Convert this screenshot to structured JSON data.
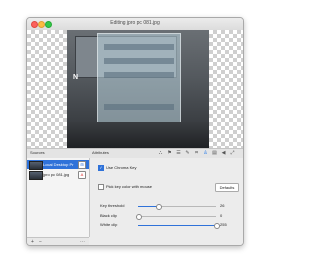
{
  "window": {
    "title": "Editing jpro pc 081.jpg"
  },
  "canvas": {
    "wordmark": "N"
  },
  "toolbar": {
    "sources_header": "Sources",
    "attributes_header": "Attributes",
    "icons": [
      "sitemap-icon",
      "flag-icon",
      "sliders-icon",
      "brush-icon",
      "crop-icon",
      "person-icon",
      "layers-icon",
      "speaker-icon",
      "arrows-icon"
    ],
    "active_icon": "person-icon"
  },
  "sources": {
    "items": [
      {
        "label": "Local Desktop Pr",
        "selected": true,
        "button": "⊞"
      },
      {
        "label": "jpro pc 081.jpg",
        "selected": false,
        "button": "A"
      }
    ],
    "bottom_buttons": [
      "+",
      "−",
      "⋯"
    ]
  },
  "attributes": {
    "use_chroma_key": {
      "label": "Use Chroma Key",
      "checked": true
    },
    "pick_key_color": {
      "label": "Pick key color with mouse",
      "checked": false
    },
    "defaults_button": "Defaults",
    "params": [
      {
        "label": "Key threshold",
        "value": "26",
        "fraction": 0.26
      },
      {
        "label": "Black clip",
        "value": "0",
        "fraction": 0.0
      },
      {
        "label": "White clip",
        "value": "255",
        "fraction": 1.0
      }
    ]
  },
  "colors": {
    "accent": "#2f72d9",
    "close": "#fc605b",
    "minimize": "#fdbc40",
    "maximize": "#34c84a"
  }
}
